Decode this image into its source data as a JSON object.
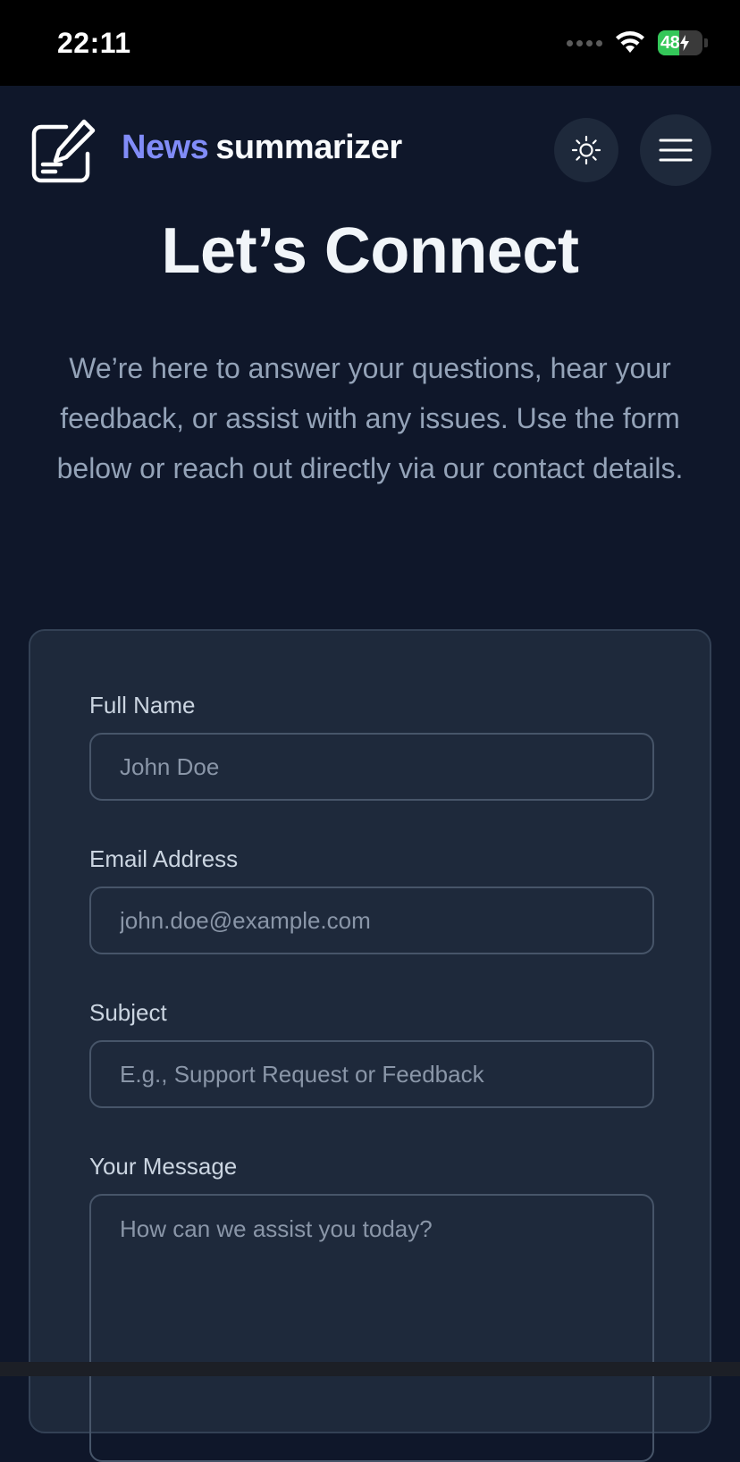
{
  "status_bar": {
    "time": "22:11",
    "battery_level": "48"
  },
  "header": {
    "brand_accent": "News",
    "brand_rest": "summarizer",
    "logo_icon": "edit-square-icon",
    "theme_icon": "sun-icon",
    "menu_icon": "hamburger-menu-icon"
  },
  "hero": {
    "title": "Let’s Connect",
    "intro": "We’re here to answer your questions, hear your feedback, or assist with any issues. Use the form below or reach out directly via our contact details."
  },
  "form": {
    "full_name": {
      "label": "Full Name",
      "placeholder": "John Doe"
    },
    "email": {
      "label": "Email Address",
      "placeholder": "john.doe@example.com"
    },
    "subject": {
      "label": "Subject",
      "placeholder": "E.g., Support Request or Feedback"
    },
    "message": {
      "label": "Your Message",
      "placeholder": "How can we assist you today?"
    }
  },
  "colors": {
    "background": "#0f172a",
    "card": "#1e293b",
    "accent": "#818cf8"
  }
}
